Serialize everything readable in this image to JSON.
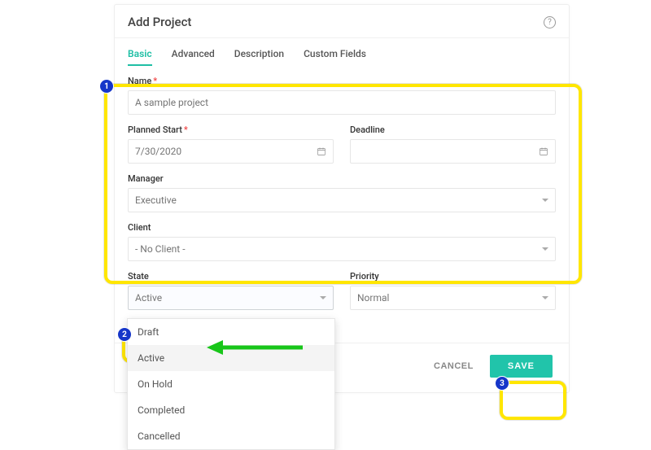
{
  "dialog": {
    "title": "Add Project",
    "tabs": [
      "Basic",
      "Advanced",
      "Description",
      "Custom Fields"
    ],
    "activeTab": "Basic"
  },
  "fields": {
    "name": {
      "label": "Name",
      "required": true,
      "value": "A sample project"
    },
    "plannedStart": {
      "label": "Planned Start",
      "required": true,
      "value": "7/30/2020"
    },
    "deadline": {
      "label": "Deadline",
      "required": false,
      "value": ""
    },
    "manager": {
      "label": "Manager",
      "required": false,
      "value": "Executive"
    },
    "client": {
      "label": "Client",
      "required": false,
      "value": "- No Client -"
    },
    "state": {
      "label": "State",
      "required": false,
      "value": "Active",
      "options": [
        "Draft",
        "Active",
        "On Hold",
        "Completed",
        "Cancelled"
      ]
    },
    "priority": {
      "label": "Priority",
      "required": false,
      "value": "Normal"
    }
  },
  "buttons": {
    "cancel": "CANCEL",
    "save": "SAVE"
  },
  "callouts": {
    "1": "1",
    "2": "2",
    "3": "3"
  }
}
